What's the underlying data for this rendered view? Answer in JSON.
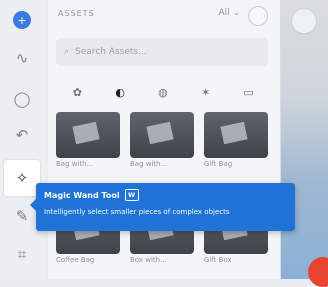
{
  "panel": {
    "title": "ASSETS",
    "more": "All ⌄",
    "search_placeholder": "Search Assets..."
  },
  "categories": [
    {
      "icon": "flower-icon"
    },
    {
      "icon": "contrast-icon"
    },
    {
      "icon": "palette-icon"
    },
    {
      "icon": "sparkle-icon"
    },
    {
      "icon": "image-icon"
    }
  ],
  "assets": [
    {
      "label": "Bag with..."
    },
    {
      "label": "Bag with..."
    },
    {
      "label": "Gift Bag"
    },
    {
      "label": "Coffee Bag"
    },
    {
      "label": "Box with..."
    },
    {
      "label": "Gift Box"
    }
  ],
  "tooltip": {
    "title": "Magic Wand Tool",
    "shortcut": "W",
    "description": "Intelligently select smaller pieces of complex objects"
  },
  "colors": {
    "accent": "#1f73d6",
    "dot": "#3d7be4"
  }
}
